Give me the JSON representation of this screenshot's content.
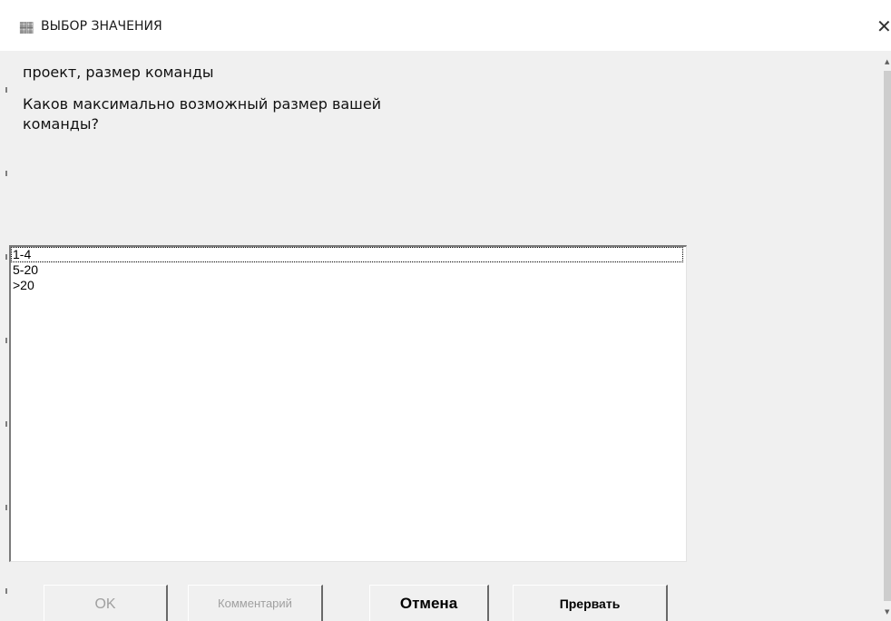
{
  "window": {
    "title": "ВЫБОР ЗНАЧЕНИЯ",
    "icon": "app-icon",
    "close_symbol": "✕"
  },
  "dialog": {
    "subtitle": "проект, размер команды",
    "question": "Каков максимально возможный размер вашей команды?"
  },
  "options": {
    "items": [
      "1-4",
      "5-20",
      ">20"
    ],
    "focused_index": 0
  },
  "buttons": {
    "ok": "OK",
    "comment": "Комментарий",
    "cancel": "Отмена",
    "abort": "Прервать"
  },
  "colors": {
    "background": "#f0f0f0",
    "disabled_text": "#a0a0a0"
  }
}
